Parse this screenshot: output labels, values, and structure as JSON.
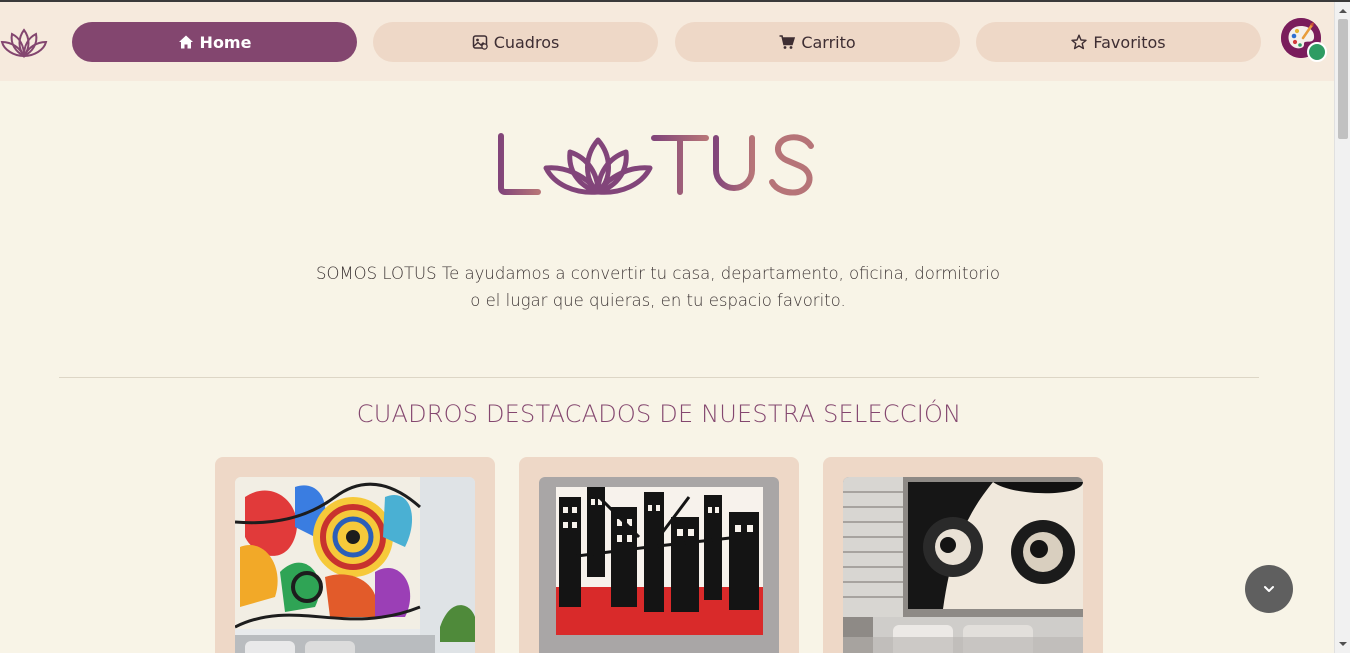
{
  "nav": {
    "items": [
      {
        "label": "Home",
        "icon": "home-icon",
        "active": true
      },
      {
        "label": "Cuadros",
        "icon": "image-icon",
        "active": false
      },
      {
        "label": "Carrito",
        "icon": "cart-icon",
        "active": false
      },
      {
        "label": "Favoritos",
        "icon": "star-icon",
        "active": false
      }
    ]
  },
  "hero": {
    "brand": "LOTUS",
    "tagline_line1": "SOMOS LOTUS Te ayudamos a convertir tu casa, departamento, oficina, dormitorio",
    "tagline_line2": "o el lugar que quieras, en tu espacio favorito."
  },
  "featured": {
    "title": "CUADROS DESTACADOS DE NUESTRA SELECCIÓN",
    "cards": [
      {
        "name": "abstract-colorful-painting"
      },
      {
        "name": "city-black-red-painting"
      },
      {
        "name": "black-white-face-painting"
      }
    ]
  },
  "colors": {
    "primary": "#83466f",
    "nav_button": "#eed8c7",
    "background": "#f8f4e7",
    "logo_gradient_start": "#82457a",
    "logo_gradient_end": "#b67478"
  }
}
